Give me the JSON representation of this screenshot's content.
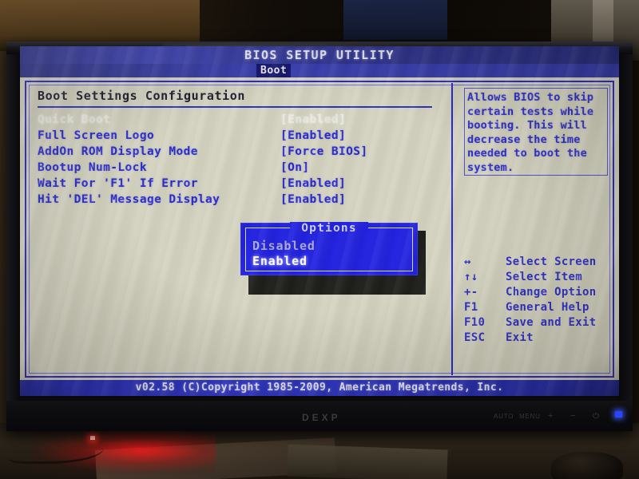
{
  "scene": {
    "device_brand": "DEXP",
    "bezel_buttons": [
      {
        "name": "auto",
        "label": "AUTO"
      },
      {
        "name": "menu",
        "label": "MENU"
      },
      {
        "name": "plus",
        "label": "+"
      },
      {
        "name": "minus",
        "label": "−"
      },
      {
        "name": "power",
        "label": "⏻"
      }
    ],
    "power_led_color": "#2b44ff"
  },
  "bios": {
    "title": "BIOS SETUP UTILITY",
    "active_tab": "Boot",
    "section_title": "Boot Settings Configuration",
    "settings": [
      {
        "label": "Quick Boot",
        "value": "[Enabled]",
        "active": true
      },
      {
        "label": "Full Screen Logo",
        "value": "[Enabled]",
        "active": false
      },
      {
        "label": "AddOn ROM Display Mode",
        "value": "[Force BIOS]",
        "active": false
      },
      {
        "label": "Bootup Num-Lock",
        "value": "[On]",
        "active": false
      },
      {
        "label": "Wait For 'F1' If Error",
        "value": "[Enabled]",
        "active": false
      },
      {
        "label": "Hit 'DEL' Message Display",
        "value": "[Enabled]",
        "active": false
      }
    ],
    "popup": {
      "title": "Options",
      "options": [
        {
          "label": "Disabled",
          "selected": false
        },
        {
          "label": "Enabled",
          "selected": true
        }
      ]
    },
    "help_text": "Allows BIOS to skip certain tests while booting. This will decrease the time needed to boot the system.",
    "keys": [
      {
        "key": "↔",
        "desc": "Select Screen"
      },
      {
        "key": "↑↓",
        "desc": "Select Item"
      },
      {
        "key": "+-",
        "desc": "Change Option"
      },
      {
        "key": "F1",
        "desc": "General Help"
      },
      {
        "key": "F10",
        "desc": "Save and Exit"
      },
      {
        "key": "ESC",
        "desc": "Exit"
      }
    ],
    "footer": "v02.58 (C)Copyright 1985-2009, American Megatrends, Inc.",
    "colors": {
      "header_blue": "#2a2e8c",
      "text_blue": "#2323c8",
      "background": "#d3d2c0",
      "popup_blue": "#1b1be0",
      "active_text": "#e9e9e0"
    }
  }
}
